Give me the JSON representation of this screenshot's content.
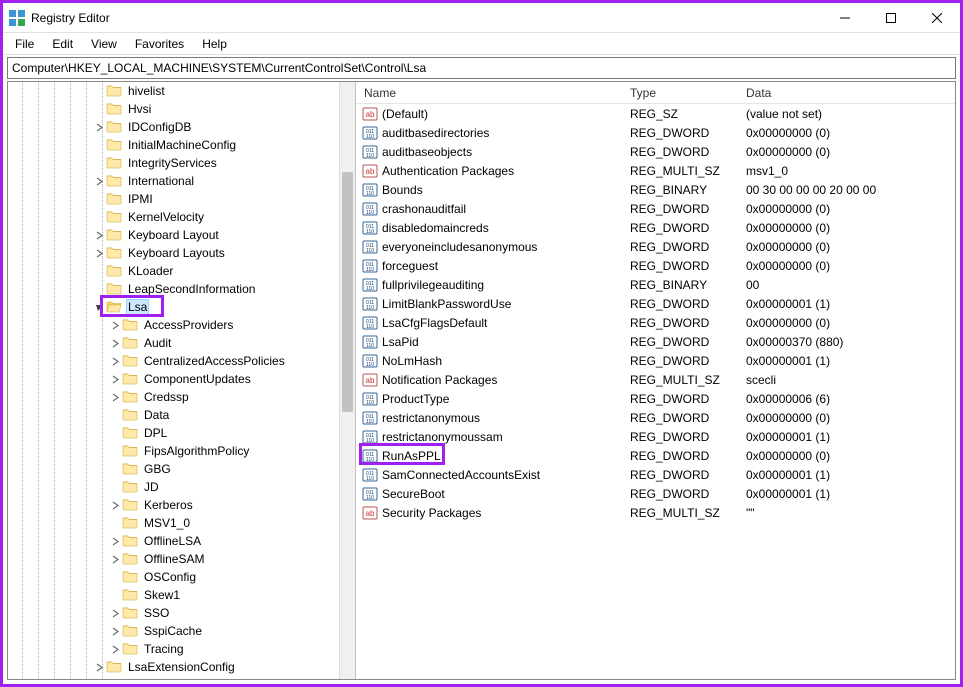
{
  "window_title": "Registry Editor",
  "menu": {
    "file": "File",
    "edit": "Edit",
    "view": "View",
    "favorites": "Favorites",
    "help": "Help"
  },
  "address": "Computer\\HKEY_LOCAL_MACHINE\\SYSTEM\\CurrentControlSet\\Control\\Lsa",
  "columns": {
    "name": "Name",
    "type": "Type",
    "data": "Data"
  },
  "tree": [
    {
      "level": 6,
      "label": "hivelist",
      "exp": ""
    },
    {
      "level": 6,
      "label": "Hvsi",
      "exp": ""
    },
    {
      "level": 6,
      "label": "IDConfigDB",
      "exp": ">"
    },
    {
      "level": 6,
      "label": "InitialMachineConfig",
      "exp": ""
    },
    {
      "level": 6,
      "label": "IntegrityServices",
      "exp": ""
    },
    {
      "level": 6,
      "label": "International",
      "exp": ">"
    },
    {
      "level": 6,
      "label": "IPMI",
      "exp": ""
    },
    {
      "level": 6,
      "label": "KernelVelocity",
      "exp": ""
    },
    {
      "level": 6,
      "label": "Keyboard Layout",
      "exp": ">"
    },
    {
      "level": 6,
      "label": "Keyboard Layouts",
      "exp": ">"
    },
    {
      "level": 6,
      "label": "KLoader",
      "exp": ""
    },
    {
      "level": 6,
      "label": "LeapSecondInformation",
      "exp": ""
    },
    {
      "level": 6,
      "label": "Lsa",
      "exp": "v",
      "selected": true
    },
    {
      "level": 7,
      "label": "AccessProviders",
      "exp": ">"
    },
    {
      "level": 7,
      "label": "Audit",
      "exp": ">"
    },
    {
      "level": 7,
      "label": "CentralizedAccessPolicies",
      "exp": ">"
    },
    {
      "level": 7,
      "label": "ComponentUpdates",
      "exp": ">"
    },
    {
      "level": 7,
      "label": "Credssp",
      "exp": ">"
    },
    {
      "level": 7,
      "label": "Data",
      "exp": ""
    },
    {
      "level": 7,
      "label": "DPL",
      "exp": ""
    },
    {
      "level": 7,
      "label": "FipsAlgorithmPolicy",
      "exp": ""
    },
    {
      "level": 7,
      "label": "GBG",
      "exp": ""
    },
    {
      "level": 7,
      "label": "JD",
      "exp": ""
    },
    {
      "level": 7,
      "label": "Kerberos",
      "exp": ">"
    },
    {
      "level": 7,
      "label": "MSV1_0",
      "exp": ""
    },
    {
      "level": 7,
      "label": "OfflineLSA",
      "exp": ">"
    },
    {
      "level": 7,
      "label": "OfflineSAM",
      "exp": ">"
    },
    {
      "level": 7,
      "label": "OSConfig",
      "exp": ""
    },
    {
      "level": 7,
      "label": "Skew1",
      "exp": ""
    },
    {
      "level": 7,
      "label": "SSO",
      "exp": ">"
    },
    {
      "level": 7,
      "label": "SspiCache",
      "exp": ">"
    },
    {
      "level": 7,
      "label": "Tracing",
      "exp": ">"
    },
    {
      "level": 6,
      "label": "LsaExtensionConfig",
      "exp": ">"
    }
  ],
  "values": [
    {
      "name": "(Default)",
      "type": "REG_SZ",
      "data": "(value not set)",
      "kind": "sz"
    },
    {
      "name": "auditbasedirectories",
      "type": "REG_DWORD",
      "data": "0x00000000 (0)",
      "kind": "bin"
    },
    {
      "name": "auditbaseobjects",
      "type": "REG_DWORD",
      "data": "0x00000000 (0)",
      "kind": "bin"
    },
    {
      "name": "Authentication Packages",
      "type": "REG_MULTI_SZ",
      "data": "msv1_0",
      "kind": "sz"
    },
    {
      "name": "Bounds",
      "type": "REG_BINARY",
      "data": "00 30 00 00 00 20 00 00",
      "kind": "bin"
    },
    {
      "name": "crashonauditfail",
      "type": "REG_DWORD",
      "data": "0x00000000 (0)",
      "kind": "bin"
    },
    {
      "name": "disabledomaincreds",
      "type": "REG_DWORD",
      "data": "0x00000000 (0)",
      "kind": "bin"
    },
    {
      "name": "everyoneincludesanonymous",
      "type": "REG_DWORD",
      "data": "0x00000000 (0)",
      "kind": "bin"
    },
    {
      "name": "forceguest",
      "type": "REG_DWORD",
      "data": "0x00000000 (0)",
      "kind": "bin"
    },
    {
      "name": "fullprivilegeauditing",
      "type": "REG_BINARY",
      "data": "00",
      "kind": "bin"
    },
    {
      "name": "LimitBlankPasswordUse",
      "type": "REG_DWORD",
      "data": "0x00000001 (1)",
      "kind": "bin"
    },
    {
      "name": "LsaCfgFlagsDefault",
      "type": "REG_DWORD",
      "data": "0x00000000 (0)",
      "kind": "bin"
    },
    {
      "name": "LsaPid",
      "type": "REG_DWORD",
      "data": "0x00000370 (880)",
      "kind": "bin"
    },
    {
      "name": "NoLmHash",
      "type": "REG_DWORD",
      "data": "0x00000001 (1)",
      "kind": "bin"
    },
    {
      "name": "Notification Packages",
      "type": "REG_MULTI_SZ",
      "data": "scecli",
      "kind": "sz"
    },
    {
      "name": "ProductType",
      "type": "REG_DWORD",
      "data": "0x00000006 (6)",
      "kind": "bin"
    },
    {
      "name": "restrictanonymous",
      "type": "REG_DWORD",
      "data": "0x00000000 (0)",
      "kind": "bin"
    },
    {
      "name": "restrictanonymoussam",
      "type": "REG_DWORD",
      "data": "0x00000001 (1)",
      "kind": "bin"
    },
    {
      "name": "RunAsPPL",
      "type": "REG_DWORD",
      "data": "0x00000000 (0)",
      "kind": "bin",
      "highlighted": true
    },
    {
      "name": "SamConnectedAccountsExist",
      "type": "REG_DWORD",
      "data": "0x00000001 (1)",
      "kind": "bin"
    },
    {
      "name": "SecureBoot",
      "type": "REG_DWORD",
      "data": "0x00000001 (1)",
      "kind": "bin"
    },
    {
      "name": "Security Packages",
      "type": "REG_MULTI_SZ",
      "data": "\"\"",
      "kind": "sz"
    }
  ]
}
